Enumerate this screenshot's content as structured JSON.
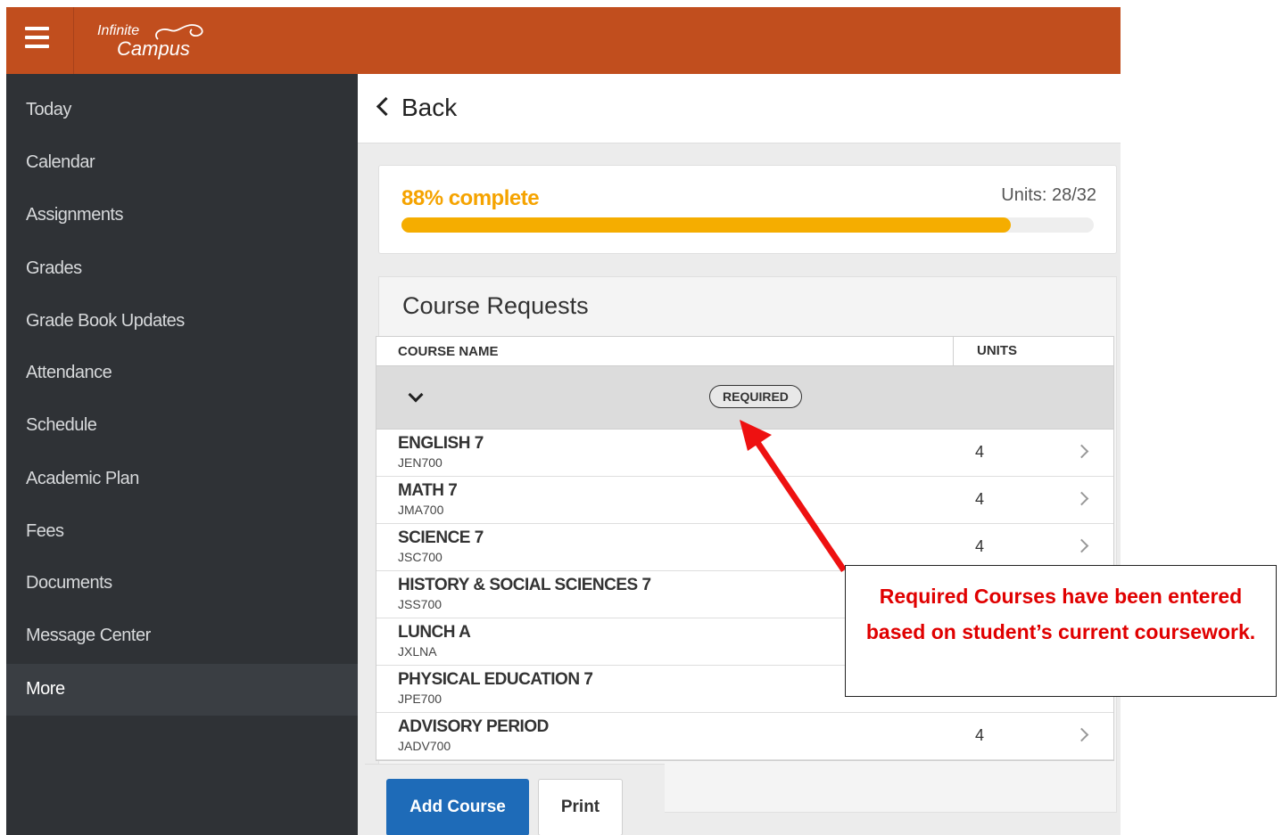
{
  "app": {
    "logo_line1": "Infinite",
    "logo_line2": "Campus"
  },
  "sidebar": {
    "items": [
      {
        "label": "Today"
      },
      {
        "label": "Calendar"
      },
      {
        "label": "Assignments"
      },
      {
        "label": "Grades"
      },
      {
        "label": "Grade Book Updates"
      },
      {
        "label": "Attendance"
      },
      {
        "label": "Schedule"
      },
      {
        "label": "Academic Plan"
      },
      {
        "label": "Fees"
      },
      {
        "label": "Documents"
      },
      {
        "label": "Message Center"
      },
      {
        "label": "More"
      }
    ]
  },
  "main": {
    "back_label": "Back",
    "progress": {
      "label": "88% complete",
      "units": "Units: 28/32",
      "fraction": 0.88,
      "color": "#f5ad00"
    },
    "courses": {
      "title": "Course Requests",
      "col_name": "COURSE NAME",
      "col_units": "UNITS",
      "required_badge": "REQUIRED",
      "rows": [
        {
          "name": "ENGLISH 7",
          "code": "JEN700",
          "units": "4"
        },
        {
          "name": "MATH 7",
          "code": "JMA700",
          "units": "4"
        },
        {
          "name": "SCIENCE 7",
          "code": "JSC700",
          "units": "4"
        },
        {
          "name": "HISTORY & SOCIAL SCIENCES 7",
          "code": "JSS700",
          "units": ""
        },
        {
          "name": "LUNCH A",
          "code": "JXLNA",
          "units": ""
        },
        {
          "name": "PHYSICAL EDUCATION 7",
          "code": "JPE700",
          "units": ""
        },
        {
          "name": "ADVISORY PERIOD",
          "code": "JADV700",
          "units": "4"
        }
      ]
    },
    "buttons": {
      "add_course": "Add Course",
      "print": "Print"
    }
  },
  "annotation": {
    "text": "Required Courses have been entered based on student’s current coursework."
  },
  "colors": {
    "topbar": "#c14e1e",
    "sidebar": "#2f3236",
    "primary_button": "#1e6bb8",
    "annotation": "#e00000"
  }
}
